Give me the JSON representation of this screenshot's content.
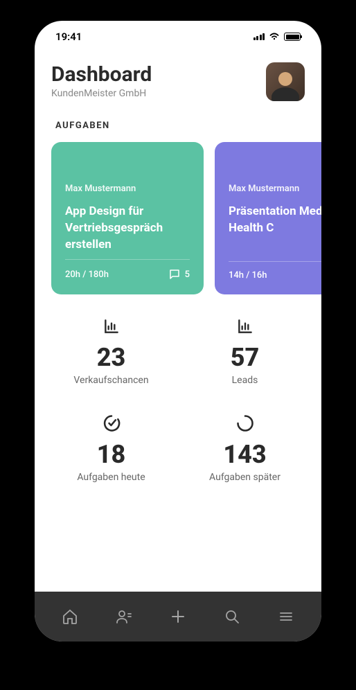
{
  "status": {
    "time": "19:41"
  },
  "header": {
    "title": "Dashboard",
    "subtitle": "KundenMeister GmbH"
  },
  "tasks": {
    "section_title": "AUFGABEN",
    "cards": [
      {
        "assignee": "Max Mustermann",
        "title": "App Design für Vertriebsgespräch erstellen",
        "hours": "20h  /  180h",
        "comments": "5",
        "color": "green"
      },
      {
        "assignee": "Max Mustermann",
        "title": "Präsentation Medical Health C",
        "hours": "14h  /  16h",
        "comments": "",
        "color": "purple"
      }
    ]
  },
  "stats": [
    {
      "icon": "bar-chart",
      "value": "23",
      "label": "Verkaufschancen"
    },
    {
      "icon": "bar-chart",
      "value": "57",
      "label": "Leads"
    },
    {
      "icon": "check-circle",
      "value": "18",
      "label": "Aufgaben heute"
    },
    {
      "icon": "progress-circle",
      "value": "143",
      "label": "Aufgaben später"
    }
  ],
  "nav": {
    "items": [
      "home",
      "contacts",
      "add",
      "search",
      "menu"
    ]
  }
}
